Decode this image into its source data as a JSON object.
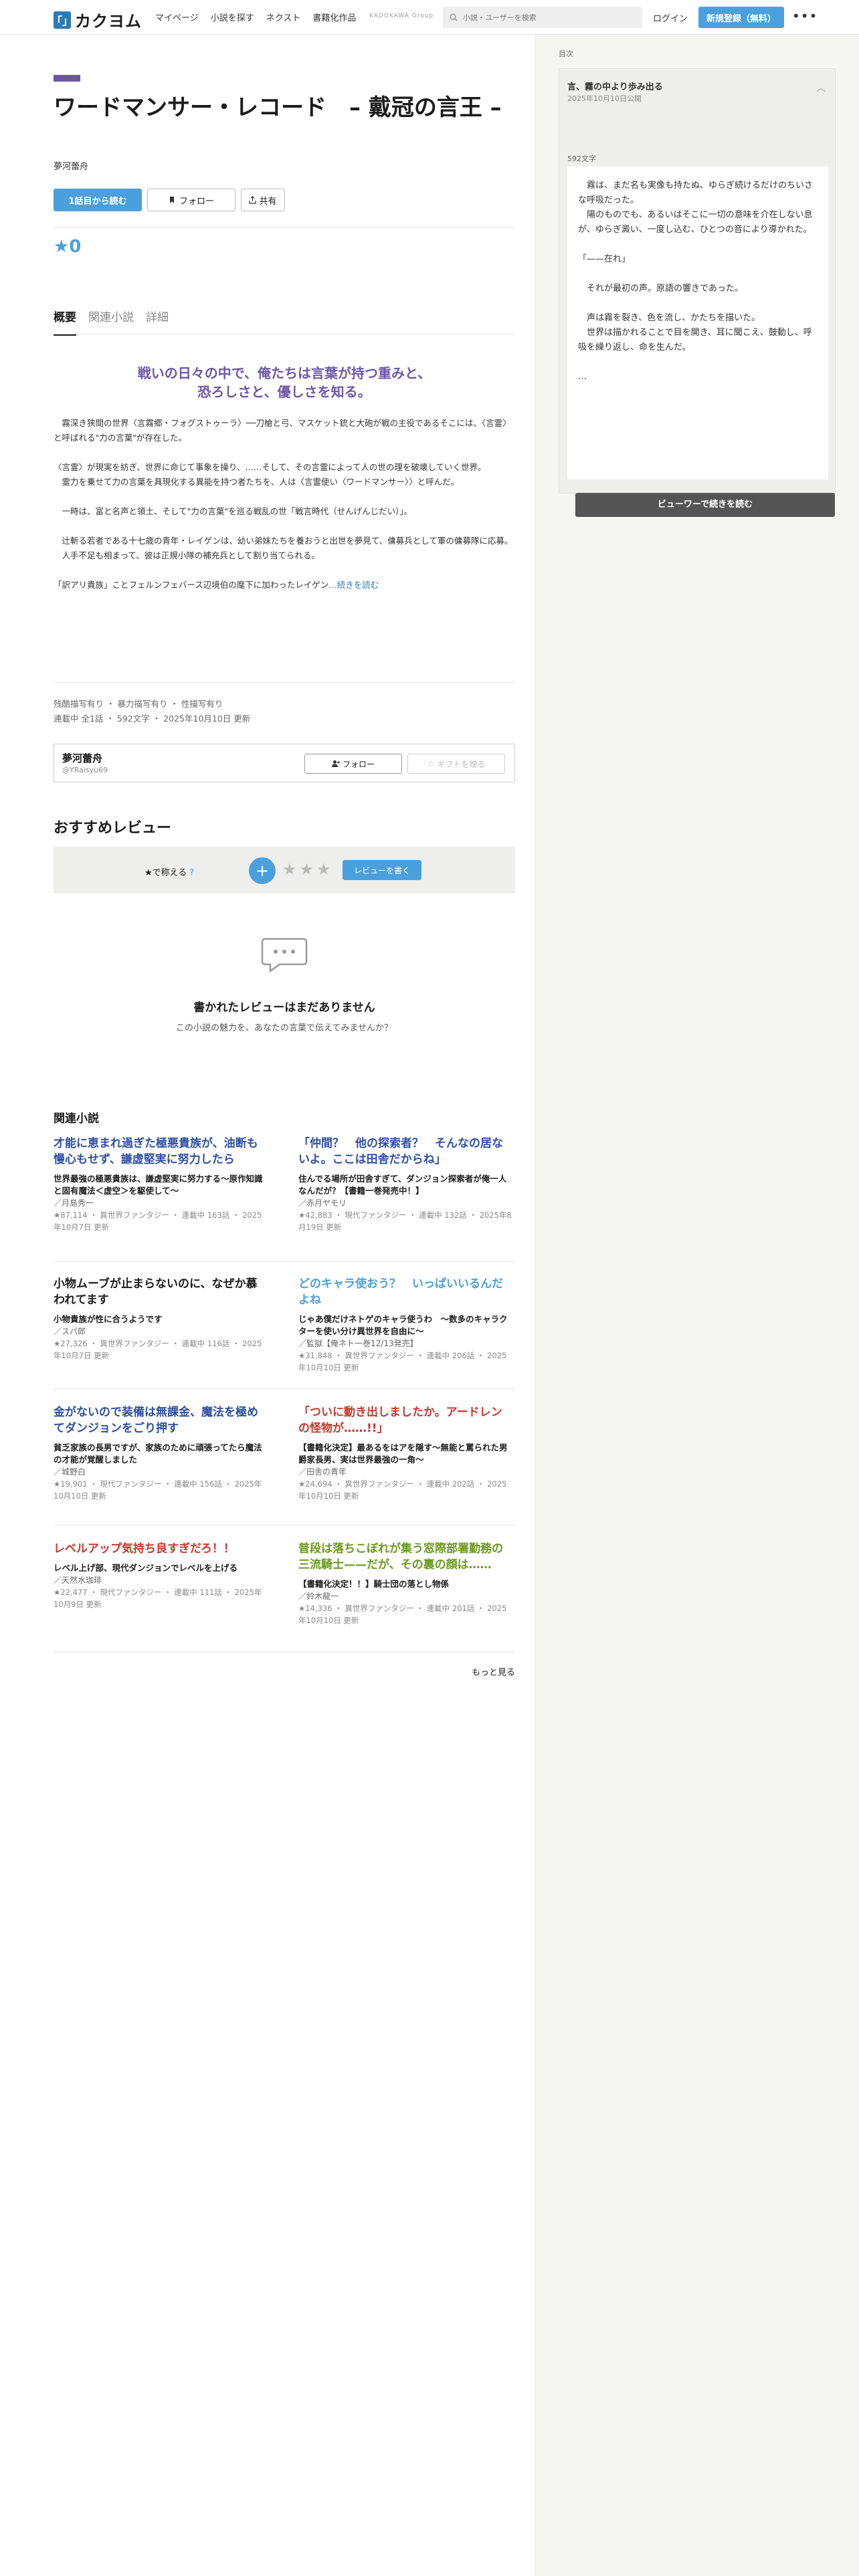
{
  "header": {
    "logo_mark": "「」",
    "logo_text": "カクヨム",
    "nav": [
      "マイページ",
      "小説を探す",
      "ネクスト",
      "書籍化作品"
    ],
    "kadokawa": "KADOKAWA Group",
    "search_placeholder": "小説・ユーザーを検索",
    "login": "ログイン",
    "signup": "新規登録（無料）",
    "more": "•••"
  },
  "work": {
    "title": "ワードマンサー・レコード　– 戴冠の言王 –",
    "author": "夢河蕾舟",
    "read_first": "1話目から読む",
    "follow": "フォロー",
    "share": "共有",
    "stars": "★0"
  },
  "tabs": [
    "概要",
    "関連小説",
    "詳細"
  ],
  "catchphrase": "戦いの日々の中で、俺たちは言葉が持つ重みと、恐ろしさと、優しさを知る。",
  "intro": [
    "　霧深き狭間の世界〈言霧郷・フォグストゥーラ〉──刀槍と弓、マスケット銃と大砲が戦の主役であるそこには、〈言霊〉と呼ばれる\"力の言葉\"が存在した。",
    "〈言霊〉が現実を紡ぎ、世界に命じて事象を操り、……そして、その言霊によって人の世の理を破壊していく世界。\n　霊力を乗せて力の言葉を具現化する異能を持つ者たちを、人は〈言霊使い〈ワードマンサー〉〉と呼んだ。",
    "　一時は、富と名声と領土、そして\"力の言葉\"を巡る戦乱の世「戦言時代（せんげんじだい）」。",
    "　辻斬る若者である十七歳の青年・レイゲンは、幼い弟妹たちを養おうと出世を夢見て、傭募兵として軍の傭募隊に応募。\n　人手不足も相まって、彼は正規小隊の補充兵として割り当てられる。",
    "「訳アリ貴族」ことフェルンフェバース辺境伯の麾下に加わったレイゲン"
  ],
  "intro_more": "…続きを読む",
  "tags_line": "残酷描写有り ・ 暴力描写有り ・ 性描写有り",
  "meta_line": "連載中 全1話 ・ 592文字 ・ 2025年10月10日 更新",
  "author_box": {
    "name": "夢河蕾舟",
    "id": "@YRaisyu69",
    "follow": "フォロー",
    "gift": "ギフトを贈る"
  },
  "reviews": {
    "heading": "おすすめレビュー",
    "label": "★で称える",
    "help": "?",
    "stars": "★★★",
    "write": "レビューを書く",
    "empty_title": "書かれたレビューはまだありません",
    "empty_sub": "この小説の魅力を、あなたの言葉で伝えてみませんか？"
  },
  "related": {
    "heading": "関連小説",
    "items": [
      {
        "title": "才能に恵まれ過ぎた極悪貴族が、油断も慢心もせず、謙虚堅実に努力したら",
        "color": "#2d4fa3",
        "sub": "世界最強の極悪貴族は、謙虚堅実に努力する〜原作知識と固有魔法＜虚空＞を駆使して〜",
        "author": "／月島秀一",
        "meta": "★87,114 ・ 異世界ファンタジー ・ 連載中 163話 ・ 2025年10月7日 更新"
      },
      {
        "title": "「仲間？　他の探索者？　そんなの居ないよ。ここは田舎だからね」",
        "color": "#2d4fa3",
        "sub": "住んでる場所が田舎すぎて、ダンジョン探索者が俺一人なんだが？【書籍一巻発売中！】",
        "author": "／赤月ヤモリ",
        "meta": "★42,883 ・ 現代ファンタジー ・ 連載中 132話 ・ 2025年8月19日 更新"
      },
      {
        "title": "小物ムーブが止まらないのに、なぜか慕われてます",
        "color": "#1c1c1c",
        "sub": "小物貴族が性に合うようです",
        "author": "／スパ郎",
        "meta": "★27,326 ・ 異世界ファンタジー ・ 連載中 116話 ・ 2025年10月7日 更新"
      },
      {
        "title": "どのキャラ使おう？　いっぱいいるんだよね",
        "color": "#4aa0dc",
        "sub": "じゃあ僕だけネトゲのキャラ使うわ　〜数多のキャラクターを使い分け異世界を自由に〜",
        "author": "／監獄【俺ネト一巻12/13発売】",
        "meta": "★31,848 ・ 異世界ファンタジー ・ 連載中 206話 ・ 2025年10月10日 更新"
      },
      {
        "title": "金がないので装備は無課金、魔法を極めてダンジョンをごり押す",
        "color": "#2d4fa3",
        "sub": "貧乏家族の長男ですが、家族のために頑張ってたら魔法の才能が覚醒しました",
        "author": "／城野白",
        "meta": "★19,901 ・ 現代ファンタジー ・ 連載中 156話 ・ 2025年10月10日 更新"
      },
      {
        "title": "「ついに動き出しましたか。アードレンの怪物が……!!」",
        "color": "#c8362a",
        "sub": "【書籍化決定】最あるをはアを隠す〜無能と罵られた男爵家長男、実は世界最強の一角〜",
        "author": "／田舎の青年",
        "meta": "★24,694 ・ 異世界ファンタジー ・ 連載中 202話 ・ 2025年10月10日 更新"
      },
      {
        "title": "レベルアップ気持ち良すぎだろ！！",
        "color": "#c8362a",
        "sub": "レベル上げ部、現代ダンジョンでレベルを上げる",
        "author": "／天然水珈琲",
        "meta": "★22,477 ・ 現代ファンタジー ・ 連載中 111話 ・ 2025年10月9日 更新"
      },
      {
        "title": "普段は落ちこぼれが集う窓際部署勤務の三流騎士——だが、その裏の顔は……",
        "color": "#6a9a1f",
        "sub": "【書籍化決定！！】騎士団の落とし物係",
        "author": "／鈴木龍一",
        "meta": "★14,336 ・ 異世界ファンタジー ・ 連載中 201話 ・ 2025年10月10日 更新"
      }
    ],
    "more": "もっと見る"
  },
  "right_panel": {
    "label": "目次",
    "episode_title": "言、霧の中より歩み出る",
    "episode_date": "2025年10月10日公開",
    "length": "592文字",
    "body": [
      "　霧は、まだ名も実像も持たぬ、ゆらぎ続けるだけのちいさな呼吸だった。\n　陽のものでも、あるいはそこに一切の意味を介在しない息が、ゆらぎ澱い、一度し込む、ひとつの音により導かれた。",
      "「——在れ」",
      "　それが最初の声。原語の響きであった。",
      "　声は霧を裂き、色を流し、かたちを描いた。\n　世界は描かれることで目を開き、耳に聞こえ、鼓動し、呼吸を繰り返し、命を生んだ。",
      "…"
    ],
    "viewer_button": "ビューワーで続きを読む"
  }
}
